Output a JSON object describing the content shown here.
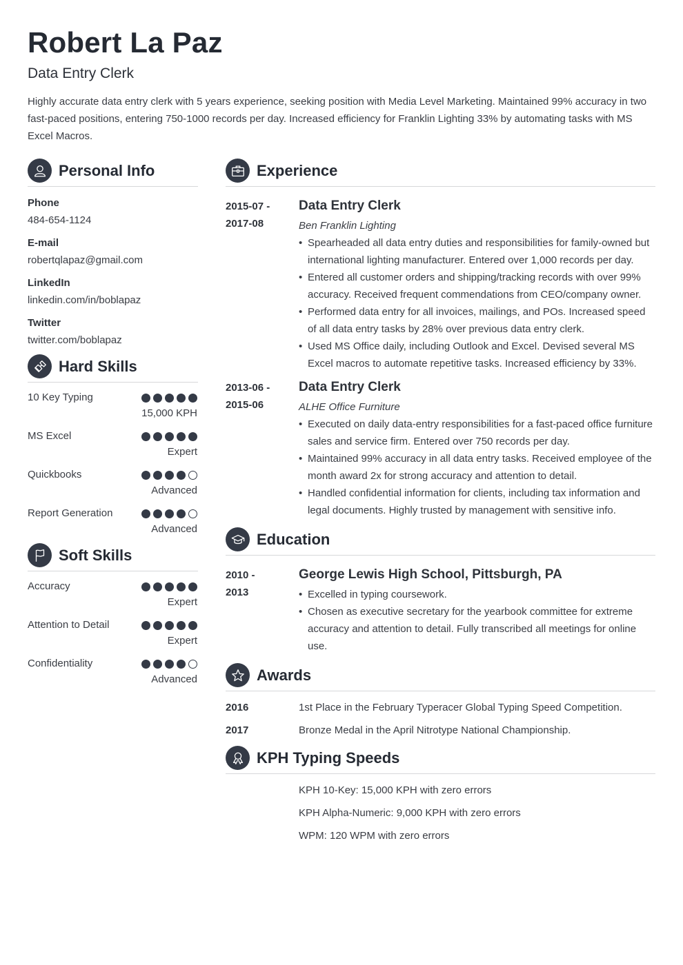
{
  "header": {
    "name": "Robert La Paz",
    "title": "Data Entry Clerk",
    "summary": "Highly accurate data entry clerk with 5 years experience, seeking position with Media Level Marketing. Maintained 99% accuracy in two fast-paced positions, entering 750-1000 records per day. Increased efficiency for Franklin Lighting 33% by automating tasks with MS Excel Macros."
  },
  "personal_info": {
    "title": "Personal Info",
    "icon": "person-icon",
    "fields": [
      {
        "label": "Phone",
        "value": "484-654-1124"
      },
      {
        "label": "E-mail",
        "value": "robertqlapaz@gmail.com"
      },
      {
        "label": "LinkedIn",
        "value": "linkedin.com/in/boblapaz"
      },
      {
        "label": "Twitter",
        "value": "twitter.com/boblapaz"
      }
    ]
  },
  "hard_skills": {
    "title": "Hard Skills",
    "icon": "puzzle-icon",
    "items": [
      {
        "name": "10 Key Typing",
        "rating": 5,
        "max": 5,
        "level": "15,000 KPH"
      },
      {
        "name": "MS Excel",
        "rating": 5,
        "max": 5,
        "level": "Expert"
      },
      {
        "name": "Quickbooks",
        "rating": 4,
        "max": 5,
        "level": "Advanced"
      },
      {
        "name": "Report Generation",
        "rating": 4,
        "max": 5,
        "level": "Advanced"
      }
    ]
  },
  "soft_skills": {
    "title": "Soft Skills",
    "icon": "flag-icon",
    "items": [
      {
        "name": "Accuracy",
        "rating": 5,
        "max": 5,
        "level": "Expert"
      },
      {
        "name": "Attention to Detail",
        "rating": 5,
        "max": 5,
        "level": "Expert"
      },
      {
        "name": "Confidentiality",
        "rating": 4,
        "max": 5,
        "level": "Advanced"
      }
    ]
  },
  "experience": {
    "title": "Experience",
    "icon": "briefcase-icon",
    "entries": [
      {
        "date_start": "2015-07 -",
        "date_end": "2017-08",
        "title": "Data Entry Clerk",
        "company": "Ben Franklin Lighting",
        "bullets": [
          "Spearheaded all data entry duties and responsibilities for family-owned but international lighting manufacturer. Entered over 1,000 records per day.",
          "Entered all customer orders and shipping/tracking records with over 99% accuracy. Received frequent commendations from CEO/company owner.",
          "Performed data entry for all invoices, mailings, and POs. Increased speed of all data entry tasks by 28% over previous data entry clerk.",
          "Used MS Office daily, including Outlook and Excel. Devised several MS Excel macros to automate repetitive tasks. Increased efficiency by 33%."
        ]
      },
      {
        "date_start": "2013-06 -",
        "date_end": "2015-06",
        "title": "Data Entry Clerk",
        "company": "ALHE Office Furniture",
        "bullets": [
          "Executed on daily data-entry responsibilities for a fast-paced office furniture sales and service firm. Entered over 750 records per day.",
          "Maintained 99% accuracy in all data entry tasks. Received employee of the month award 2x for strong accuracy and attention to detail.",
          "Handled confidential information for clients, including tax information and legal documents. Highly trusted by management with sensitive info."
        ]
      }
    ]
  },
  "education": {
    "title": "Education",
    "icon": "graduation-cap-icon",
    "entries": [
      {
        "date_start": "2010 -",
        "date_end": "2013",
        "title": "George Lewis High School, Pittsburgh, PA",
        "bullets": [
          "Excelled in typing coursework.",
          "Chosen as executive secretary for the yearbook committee for extreme accuracy and attention to detail. Fully transcribed all meetings for online use."
        ]
      }
    ]
  },
  "awards": {
    "title": "Awards",
    "icon": "star-icon",
    "items": [
      {
        "year": "2016",
        "text": "1st Place in the February Typeracer Global Typing Speed Competition."
      },
      {
        "year": "2017",
        "text": "Bronze Medal in the April Nitrotype National Championship."
      }
    ]
  },
  "typing_speeds": {
    "title": "KPH Typing Speeds",
    "icon": "ribbon-badge-icon",
    "items": [
      "KPH 10-Key: 15,000 KPH with zero errors",
      "KPH Alpha-Numeric: 9,000 KPH with zero errors",
      "WPM: 120 WPM with zero errors"
    ]
  },
  "colors": {
    "icon_bg": "#343a46",
    "heading": "#252a33",
    "body_text": "#3a3d44",
    "divider": "#d6d7d9"
  }
}
